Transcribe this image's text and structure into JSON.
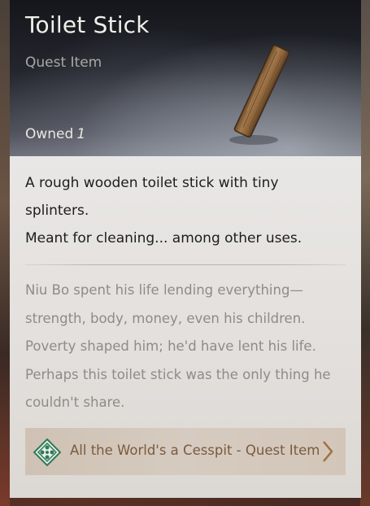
{
  "item": {
    "name": "Toilet Stick",
    "category": "Quest Item",
    "owned_label": "Owned",
    "owned_count": "1",
    "description_lines": [
      "A rough wooden toilet stick with tiny splinters.",
      "Meant for cleaning... among other uses."
    ],
    "lore": "Niu Bo spent his life lending everything—strength, body, money, even his children. Poverty shaped him; he'd have lent his life. Perhaps this toilet stick was the only thing he couldn't share."
  },
  "quest_link": {
    "label": "All the World's a Cesspit - Quest Item"
  },
  "icons": {
    "item_image": "wooden-stick-icon",
    "quest": "quest-diamond-icon",
    "chevron": "chevron-right-icon"
  },
  "colors": {
    "title": "#f1efe9",
    "subtitle": "#a9a8a5",
    "description": "#1f1d1b",
    "lore": "#8f8b86",
    "quest_label": "#7a5a3e",
    "quest_icon": "#2f7a5a"
  }
}
